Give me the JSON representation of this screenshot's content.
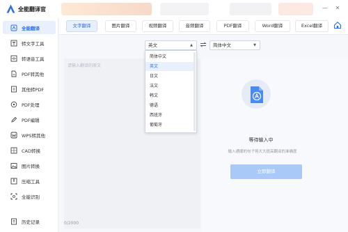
{
  "app": {
    "title": "全能翻译官"
  },
  "sidebar": {
    "items": [
      {
        "label": "全能翻译",
        "icon": "translate-icon",
        "active": true
      },
      {
        "label": "转文字工具",
        "icon": "text-convert-icon"
      },
      {
        "label": "转语音工具",
        "icon": "voice-icon"
      },
      {
        "label": "PDF转其他",
        "icon": "pdf-export-icon"
      },
      {
        "label": "其他转PDF",
        "icon": "pdf-import-icon"
      },
      {
        "label": "PDF处理",
        "icon": "pdf-process-icon"
      },
      {
        "label": "PDF编辑",
        "icon": "pdf-edit-icon"
      },
      {
        "label": "WPS转其他",
        "icon": "wps-icon"
      },
      {
        "label": "CAD转换",
        "icon": "cad-icon"
      },
      {
        "label": "图片转换",
        "icon": "image-icon"
      },
      {
        "label": "压缩工具",
        "icon": "compress-icon"
      },
      {
        "label": "全能识别",
        "icon": "recognize-icon"
      },
      {
        "label": "历史记录",
        "icon": "history-icon"
      }
    ]
  },
  "tabs": [
    {
      "label": "文字翻译",
      "active": true
    },
    {
      "label": "图片翻译"
    },
    {
      "label": "视频翻译"
    },
    {
      "label": "音频翻译"
    },
    {
      "label": "PDF翻译"
    },
    {
      "label": "Word翻译"
    },
    {
      "label": "Excel翻译"
    }
  ],
  "translate": {
    "source_lang": "英文",
    "target_lang": "简体中文",
    "placeholder": "请输入翻译的原文",
    "char_count": "0/2000",
    "waiting_title": "等待输入中",
    "waiting_sub": "输入通顺的句子将大大提高翻译的准确度",
    "button": "立即翻译"
  },
  "dropdown": {
    "options": [
      "简体中文",
      "英文",
      "日文",
      "法文",
      "韩文",
      "德语",
      "西班牙",
      "葡萄牙"
    ],
    "selected": "英文"
  },
  "colors": {
    "accent": "#2e6fe8",
    "button": "#a9c9f8",
    "active_bg": "#e8f0fe"
  }
}
